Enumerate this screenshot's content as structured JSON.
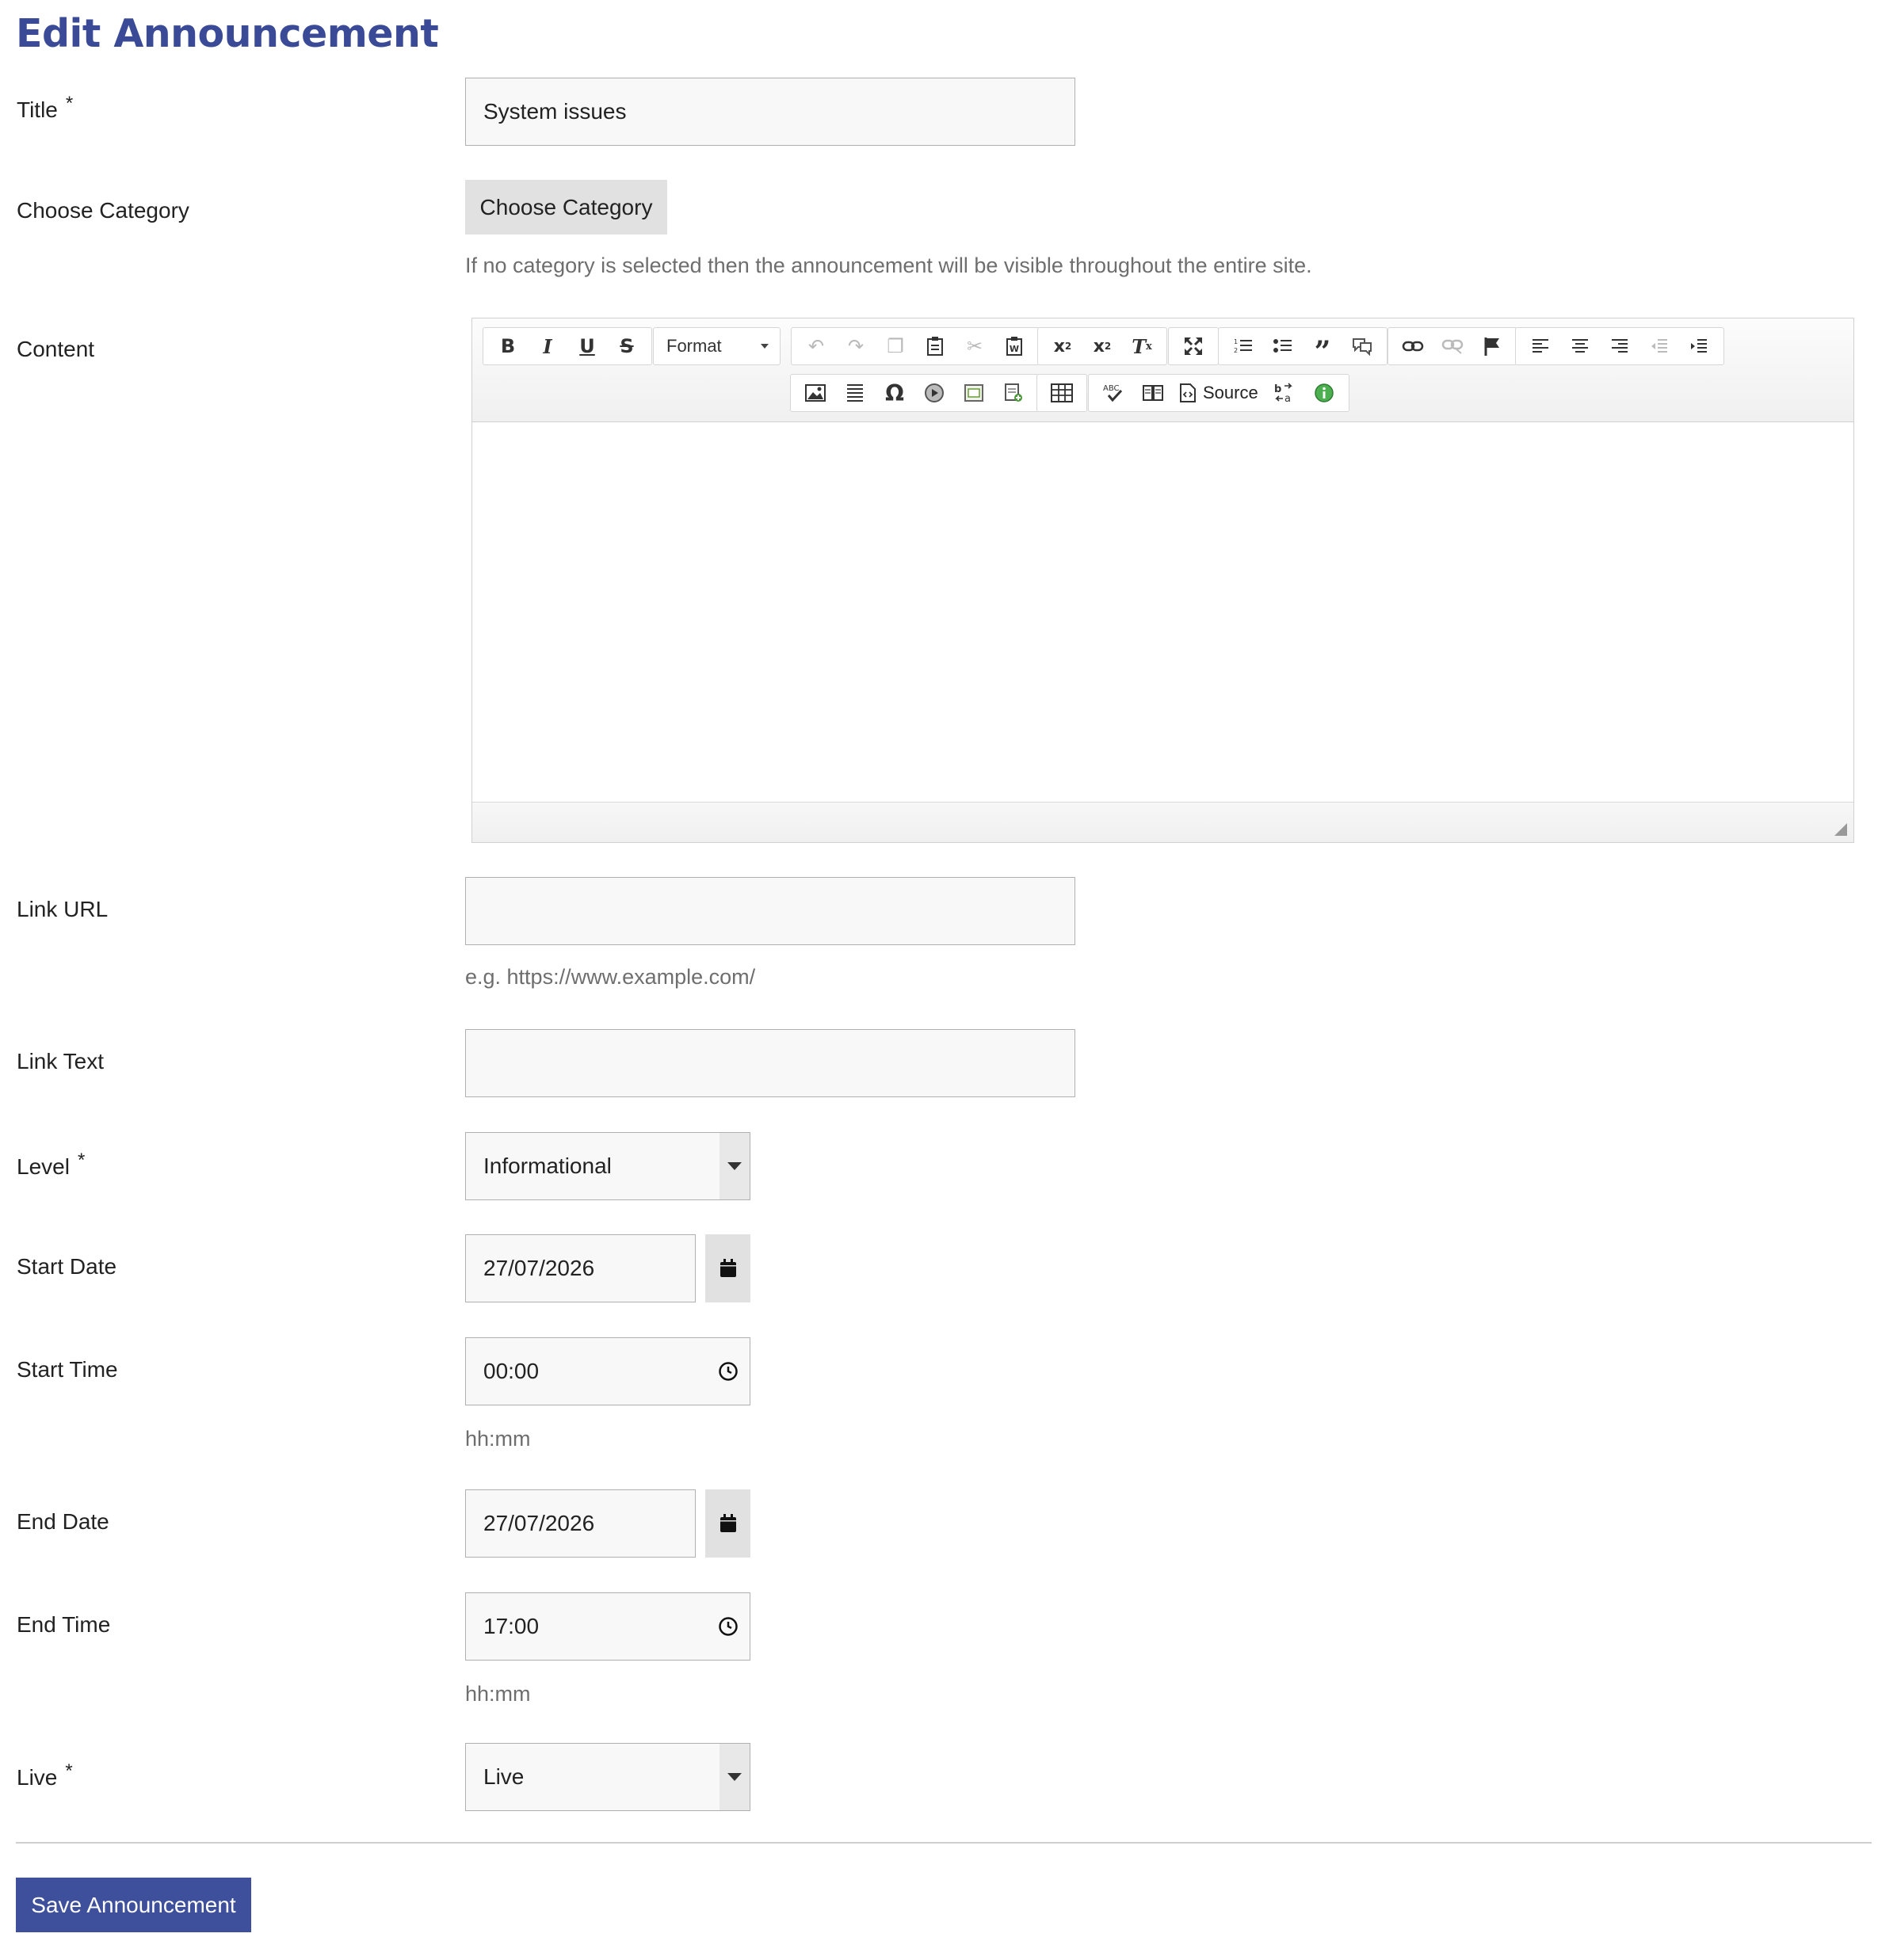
{
  "page": {
    "title": "Edit Announcement"
  },
  "required_mark": "*",
  "form": {
    "title": {
      "label": "Title",
      "value": "System issues"
    },
    "category": {
      "label": "Choose Category",
      "button_label": "Choose Category",
      "help": "If no category is selected then the announcement will be visible throughout the entire site."
    },
    "content": {
      "label": "Content",
      "toolbar": {
        "format_label": "Format",
        "source_label": "Source"
      }
    },
    "link_url": {
      "label": "Link URL",
      "value": "",
      "help": "e.g. https://www.example.com/"
    },
    "link_text": {
      "label": "Link Text",
      "value": ""
    },
    "level": {
      "label": "Level",
      "value": "Informational"
    },
    "start_date": {
      "label": "Start Date",
      "value": "27/07/2026"
    },
    "start_time": {
      "label": "Start Time",
      "value": "00:00",
      "help": "hh:mm"
    },
    "end_date": {
      "label": "End Date",
      "value": "27/07/2026"
    },
    "end_time": {
      "label": "End Time",
      "value": "17:00",
      "help": "hh:mm"
    },
    "live": {
      "label": "Live",
      "value": "Live"
    }
  },
  "actions": {
    "save_label": "Save Announcement"
  },
  "colors": {
    "brand": "#3a4a96",
    "button": "#3e4f9b",
    "field_bg": "#f8f8f8",
    "field_border": "#b0b0b0"
  }
}
